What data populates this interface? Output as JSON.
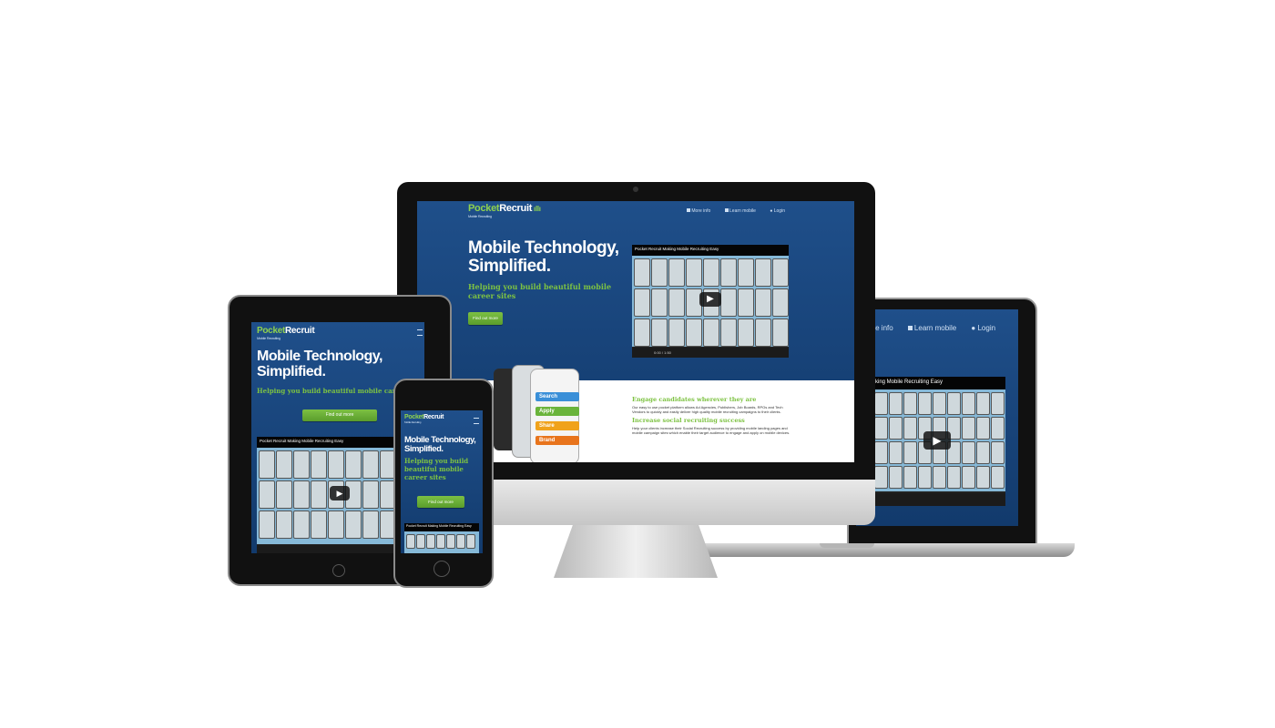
{
  "brand": {
    "logo_pocket": "Pocket",
    "logo_recruit": "Recruit",
    "tagline": "Mobile Recruiting"
  },
  "nav": {
    "more_info": "More info",
    "learn_mobile": "Learn mobile",
    "login": "Login"
  },
  "hero": {
    "title_line1": "Mobile Technology,",
    "title_line2": "Simplified.",
    "subtitle": "Helping you build beautiful mobile career sites",
    "cta": "Find out more"
  },
  "video": {
    "title": "Pocket Recruit Making Mobile Recruiting Easy",
    "laptop_title": "king Mobile Recruiting Easy",
    "time": "0:00 / 1:50"
  },
  "features": {
    "heading1": "Engage candidates wherever they are",
    "text1": "Our easy to use pocket platform allows Ad Agencies, Publishers, Job Boards, RPOs and Tech Vendors to quickly and easily deliver high quality mobile recruiting campaigns to their clients.",
    "heading2": "Increase social recruiting success",
    "text2": "Help your clients increase their Social Recruiting success by providing mobile landing pages and mobile campaign sites which enable their target audience to engage and apply on mobile devices."
  },
  "app_actions": {
    "search": "Search",
    "apply": "Apply",
    "share": "Share",
    "brand": "Brand"
  },
  "laptop_nav": {
    "more_info": "ore info",
    "learn_mobile": "Learn mobile",
    "login": "Login"
  },
  "colors": {
    "site_blue": "#1a4a84",
    "accent_green": "#7dc242",
    "search_blue": "#3a8fd8",
    "apply_green": "#6ab43b",
    "share_orange": "#f0a21b",
    "brand_orange": "#e8741c"
  }
}
